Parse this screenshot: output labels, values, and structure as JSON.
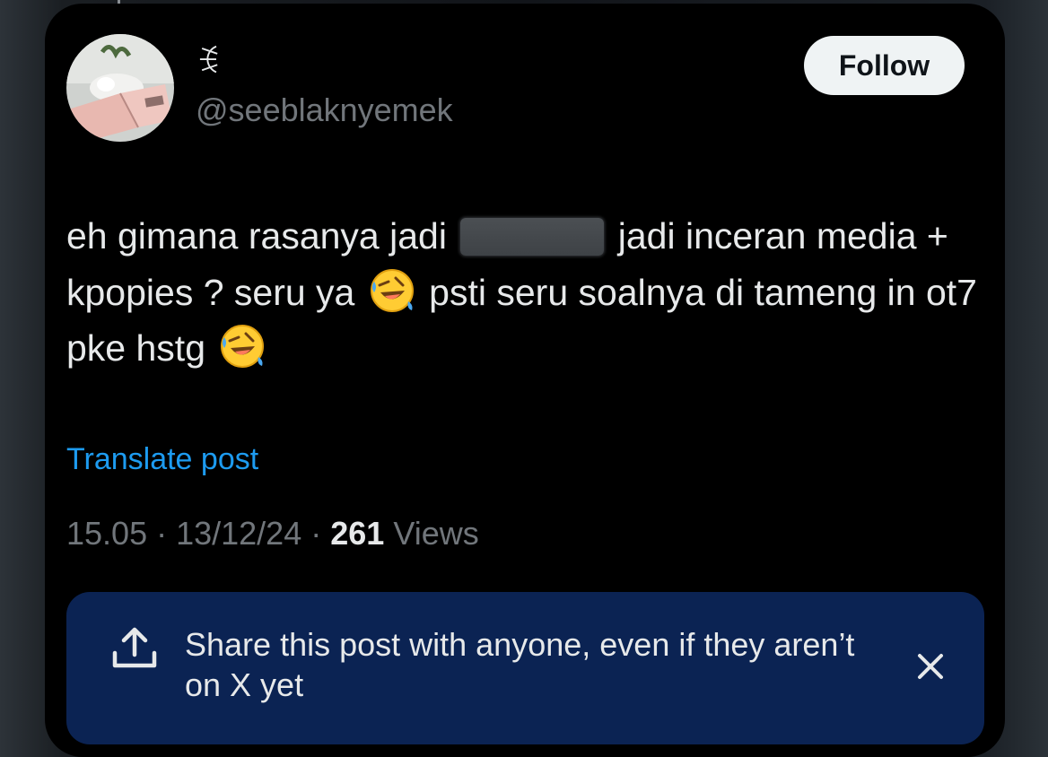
{
  "author": {
    "display_name": "ꉂ",
    "handle": "@seeblaknyemek"
  },
  "follow_label": "Follow",
  "post": {
    "text_part1": "eh gimana rasanya jadi",
    "text_part2": "jadi inceran media + kpopies ? seru ya",
    "text_part3": "psti seru soalnya di tameng in ot7 pke hstg",
    "emoji": "rolling-on-the-floor-laughing"
  },
  "translate_label": "Translate post",
  "meta": {
    "time": "15.05",
    "date": "13/12/24",
    "views_count": "261",
    "views_label": "Views"
  },
  "share_banner": {
    "text": "Share this post with anyone, even if they aren’t on X yet"
  },
  "colors": {
    "accent": "#1d9bf0",
    "banner": "#0b2353",
    "muted": "#71767b",
    "text": "#e7e9ea"
  }
}
